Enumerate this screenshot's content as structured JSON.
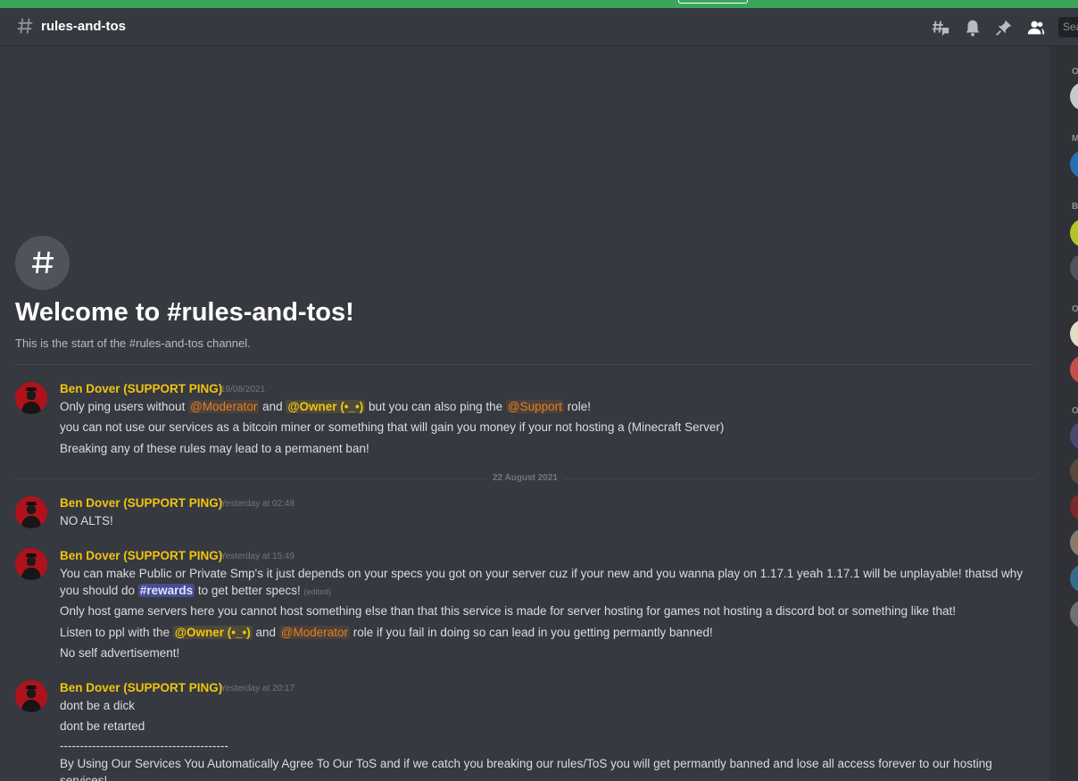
{
  "header": {
    "channel_name": "rules-and-tos",
    "search_placeholder": "Sea"
  },
  "colors": {
    "accent_top": "#3ba55c",
    "author": "#f1c40f",
    "moderator_role": "#e67e22",
    "owner_role": "#f1c40f",
    "support_role": "#e67e22"
  },
  "welcome": {
    "title": "Welcome to #rules-and-tos!",
    "subtitle": "This is the start of the #rules-and-tos channel."
  },
  "date_divider": "22 August 2021",
  "messages": [
    {
      "author": "Ben Dover (SUPPORT PING)",
      "timestamp": "19/08/2021",
      "lines": {
        "l1_a": "Only ping users without",
        "l1_mod": "@Moderator",
        "l1_b": "and",
        "l1_owner": "@Owner (•_•)",
        "l1_c": "but you can also ping the",
        "l1_support": "@Support",
        "l1_d": "role!",
        "l2": "you can not use our services as a bitcoin miner or something that will gain you money if your not hosting a (Minecraft Server)",
        "l3": "Breaking any of these rules may lead to a permanent ban!"
      }
    },
    {
      "author": "Ben Dover (SUPPORT PING)",
      "timestamp": "Yesterday at 02:48",
      "lines": {
        "l1": "NO ALTS!"
      }
    },
    {
      "author": "Ben Dover (SUPPORT PING)",
      "timestamp": "Yesterday at 15:49",
      "lines": {
        "l1": "You can make Public or Private Smp's it just depends on your specs you got on your server cuz if your new and you wanna play on 1.17.1 yeah 1.17.1 will be unplayable! thatsd why",
        "l2_a": "you should do",
        "l2_channel": "#rewards",
        "l2_b": "to get better specs!",
        "l2_edited": "(edited)",
        "l3": "Only host game servers here you cannot host something else than that this service is made for server hosting for games not hosting a discord bot or something like that!",
        "l4_a": "Listen to ppl with the",
        "l4_owner": "@Owner (•_•)",
        "l4_b": "and",
        "l4_mod": "@Moderator",
        "l4_c": "role if you fail in doing so can lead in you getting permantly banned!",
        "l5": "No self advertisement!"
      }
    },
    {
      "author": "Ben Dover (SUPPORT PING)",
      "timestamp": "Yesterday at 20:17",
      "lines": {
        "l1": "dont be a dick",
        "l2": "dont be retarted",
        "l3": "------------------------------------------",
        "l4": "By Using Our Services You Automatically Agree To Our ToS and if we catch you breaking our rules/ToS you will get permantly banned and lose all access forever to our hosting",
        "l5": "services!"
      }
    }
  ],
  "member_list": {
    "categories": [
      "O",
      "M",
      "B",
      "O",
      "O"
    ]
  }
}
